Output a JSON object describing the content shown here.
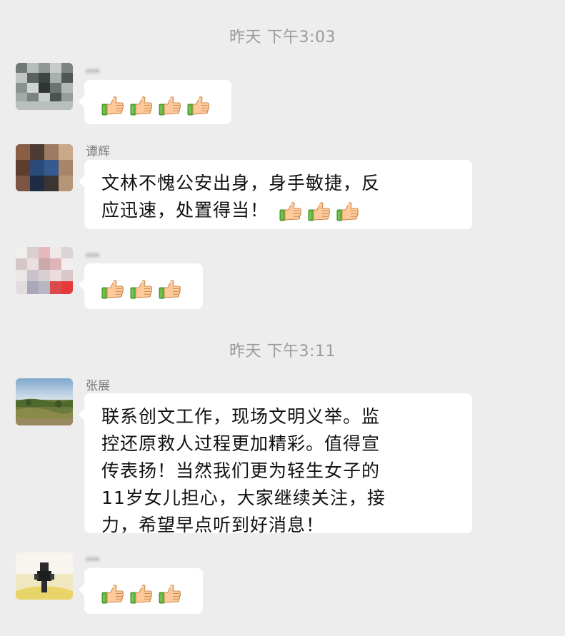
{
  "messages_group_1": {
    "timestamp": "昨天 下午3:03"
  },
  "msg1": {
    "sender": "...",
    "emoji_count": 4,
    "emoji_name": "thumbs-up-icon"
  },
  "msg2": {
    "sender": "谭辉",
    "text_line1": "文林不愧公安出身，身手敏捷，反",
    "text_line2": "应迅速，处置得当！",
    "emoji_count": 3,
    "emoji_name": "thumbs-up-icon"
  },
  "msg3": {
    "sender": "...",
    "emoji_count": 3,
    "emoji_name": "thumbs-up-icon"
  },
  "messages_group_2": {
    "timestamp": "昨天 下午3:11"
  },
  "msg4": {
    "sender": "张展",
    "lines": [
      "联系创文工作，现场文明义举。监",
      "控还原救人过程更加精彩。值得宣",
      "传表扬！当然我们更为轻生女子的",
      "11岁女儿担心，大家继续关注，接",
      "力，希望早点听到好消息！"
    ]
  },
  "msg5": {
    "sender": "...",
    "emoji_count": 3,
    "emoji_name": "thumbs-up-icon"
  },
  "colors": {
    "background": "#ededed",
    "bubble": "#ffffff",
    "timestamp_text": "#9a9a9a",
    "sender_text": "#7d7d7d"
  }
}
